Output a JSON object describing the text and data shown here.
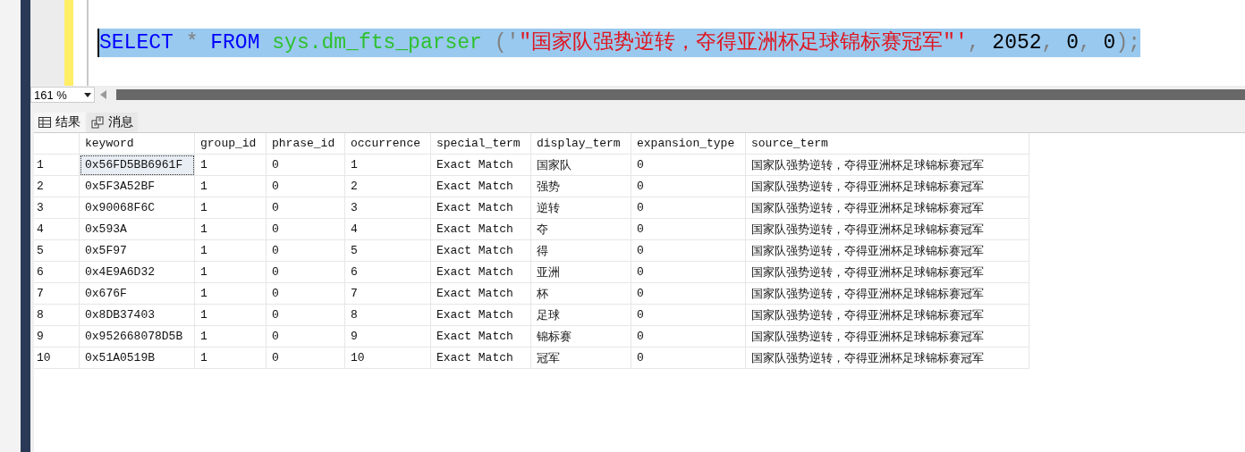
{
  "editor": {
    "tokens": [
      {
        "kind": "keyword",
        "text": "SELECT"
      },
      {
        "kind": "operator",
        "text": " * "
      },
      {
        "kind": "keyword",
        "text": "FROM"
      },
      {
        "kind": "function",
        "text": " sys.dm_fts_parser "
      },
      {
        "kind": "punct",
        "text": "('"
      },
      {
        "kind": "string",
        "text": "\"国家队强势逆转，夺得亚洲杯足球锦标赛冠军\"'"
      },
      {
        "kind": "punct",
        "text": ", "
      },
      {
        "kind": "number",
        "text": "2052"
      },
      {
        "kind": "punct",
        "text": ", "
      },
      {
        "kind": "number",
        "text": "0"
      },
      {
        "kind": "punct",
        "text": ", "
      },
      {
        "kind": "number",
        "text": "0"
      },
      {
        "kind": "punct",
        "text": ");"
      }
    ],
    "selected": true
  },
  "zoom": {
    "value": "161 %"
  },
  "tabs": [
    {
      "label": "结果",
      "selected": true
    },
    {
      "label": "消息",
      "selected": false
    }
  ],
  "table": {
    "columns": [
      "keyword",
      "group_id",
      "phrase_id",
      "occurrence",
      "special_term",
      "display_term",
      "expansion_type",
      "source_term"
    ],
    "rows": [
      {
        "number": "1",
        "focused": true,
        "cells": [
          "0x56FD5BB6961F",
          "1",
          "0",
          "1",
          "Exact Match",
          "国家队",
          "0",
          "国家队强势逆转，夺得亚洲杯足球锦标赛冠军"
        ]
      },
      {
        "number": "2",
        "focused": false,
        "cells": [
          "0x5F3A52BF",
          "1",
          "0",
          "2",
          "Exact Match",
          "强势",
          "0",
          "国家队强势逆转，夺得亚洲杯足球锦标赛冠军"
        ]
      },
      {
        "number": "3",
        "focused": false,
        "cells": [
          "0x90068F6C",
          "1",
          "0",
          "3",
          "Exact Match",
          "逆转",
          "0",
          "国家队强势逆转，夺得亚洲杯足球锦标赛冠军"
        ]
      },
      {
        "number": "4",
        "focused": false,
        "cells": [
          "0x593A",
          "1",
          "0",
          "4",
          "Exact Match",
          "夺",
          "0",
          "国家队强势逆转，夺得亚洲杯足球锦标赛冠军"
        ]
      },
      {
        "number": "5",
        "focused": false,
        "cells": [
          "0x5F97",
          "1",
          "0",
          "5",
          "Exact Match",
          "得",
          "0",
          "国家队强势逆转，夺得亚洲杯足球锦标赛冠军"
        ]
      },
      {
        "number": "6",
        "focused": false,
        "cells": [
          "0x4E9A6D32",
          "1",
          "0",
          "6",
          "Exact Match",
          "亚洲",
          "0",
          "国家队强势逆转，夺得亚洲杯足球锦标赛冠军"
        ]
      },
      {
        "number": "7",
        "focused": false,
        "cells": [
          "0x676F",
          "1",
          "0",
          "7",
          "Exact Match",
          "杯",
          "0",
          "国家队强势逆转，夺得亚洲杯足球锦标赛冠军"
        ]
      },
      {
        "number": "8",
        "focused": false,
        "cells": [
          "0x8DB37403",
          "1",
          "0",
          "8",
          "Exact Match",
          "足球",
          "0",
          "国家队强势逆转，夺得亚洲杯足球锦标赛冠军"
        ]
      },
      {
        "number": "9",
        "focused": false,
        "cells": [
          "0x952668078D5B",
          "1",
          "0",
          "9",
          "Exact Match",
          "锦标赛",
          "0",
          "国家队强势逆转，夺得亚洲杯足球锦标赛冠军"
        ]
      },
      {
        "number": "10",
        "focused": false,
        "cells": [
          "0x51A0519B",
          "1",
          "0",
          "10",
          "Exact Match",
          "冠军",
          "0",
          "国家队强势逆转，夺得亚洲杯足球锦标赛冠军"
        ]
      }
    ]
  }
}
